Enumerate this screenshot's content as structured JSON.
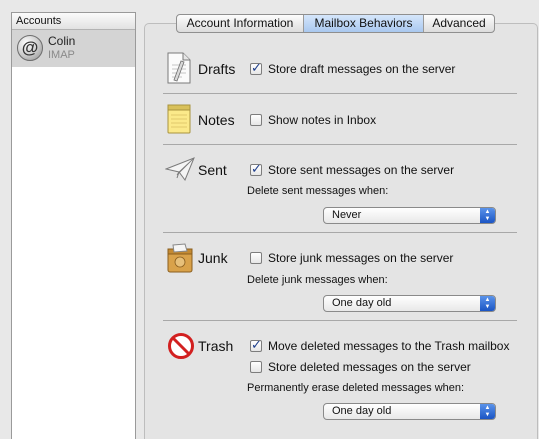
{
  "sidebar": {
    "header": "Accounts",
    "accounts": [
      {
        "name": "Colin",
        "type": "IMAP",
        "icon": "at-sign-icon"
      }
    ]
  },
  "tabs": [
    {
      "label": "Account Information",
      "selected": false
    },
    {
      "label": "Mailbox Behaviors",
      "selected": true
    },
    {
      "label": "Advanced",
      "selected": false
    }
  ],
  "sections": {
    "drafts": {
      "title": "Drafts",
      "icon": "drafts-document-icon",
      "store_label": "Store draft messages on the server",
      "store_checked": true
    },
    "notes": {
      "title": "Notes",
      "icon": "notepad-icon",
      "show_label": "Show notes in Inbox",
      "show_checked": false
    },
    "sent": {
      "title": "Sent",
      "icon": "paper-plane-icon",
      "store_label": "Store sent messages on the server",
      "store_checked": true,
      "delete_label": "Delete sent messages when:",
      "delete_value": "Never"
    },
    "junk": {
      "title": "Junk",
      "icon": "junk-mail-icon",
      "store_label": "Store junk messages on the server",
      "store_checked": false,
      "delete_label": "Delete junk messages when:",
      "delete_value": "One day old"
    },
    "trash": {
      "title": "Trash",
      "icon": "no-entry-icon",
      "move_label": "Move deleted messages to the Trash mailbox",
      "move_checked": true,
      "store_label": "Store deleted messages on the server",
      "store_checked": false,
      "erase_label": "Permanently erase deleted messages when:",
      "erase_value": "One day old"
    }
  },
  "colors": {
    "selected_tab": "#a9c8ef",
    "popup_arrow": "#1b55c4",
    "trash_icon": "#d22020"
  }
}
